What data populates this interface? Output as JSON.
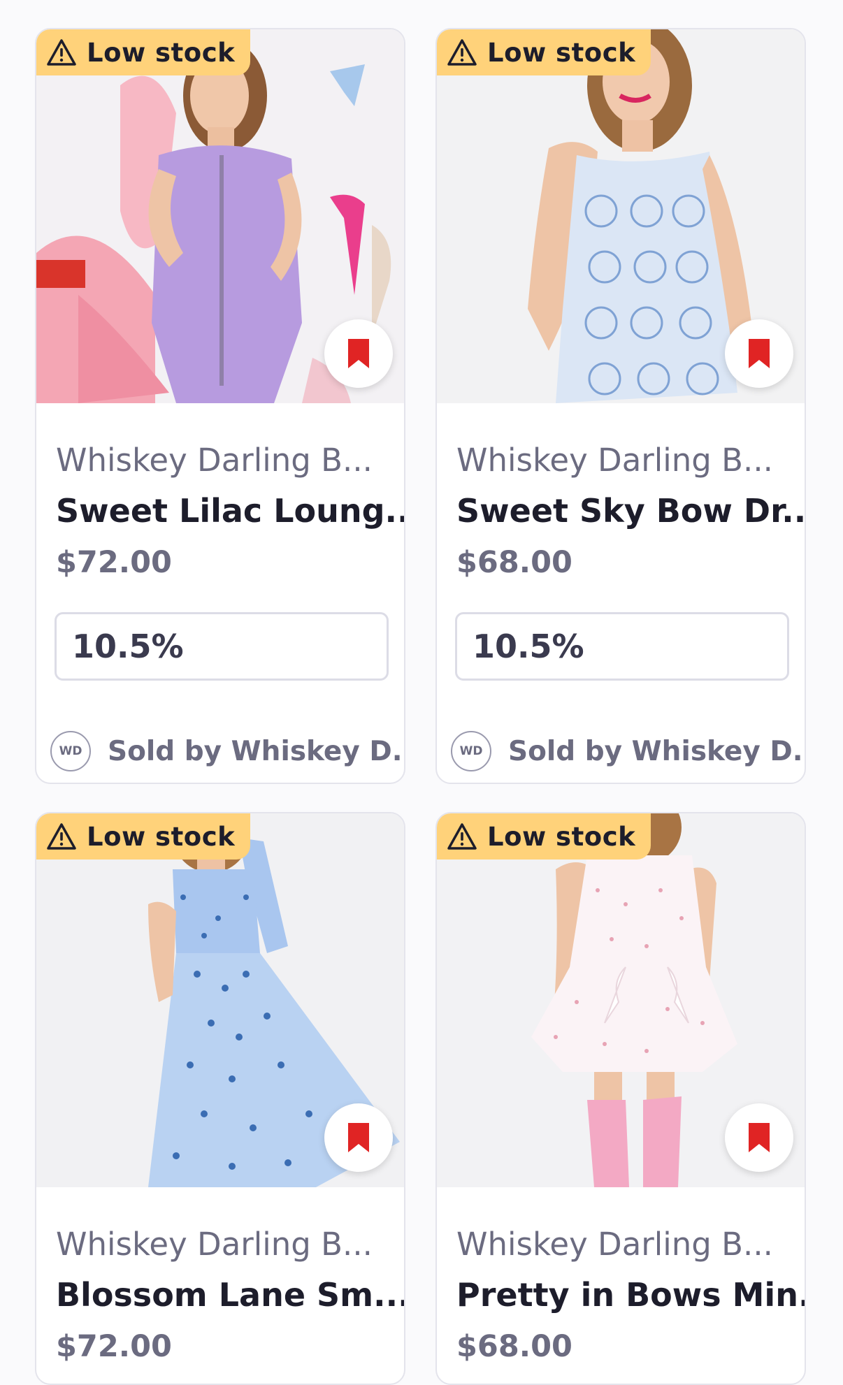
{
  "badge_label": "Low stock",
  "colors": {
    "badge_bg": "#ffd27a",
    "bookmark": "#e02424",
    "text_dark": "#1d1d2b",
    "text_muted": "#6b6b80"
  },
  "products": [
    {
      "brand": "Whiskey Darling B...",
      "title": "Sweet Lilac Loung...",
      "price": "$72.00",
      "commission": "10.5%",
      "seller_initials": "WD",
      "seller": "Sold by Whiskey D..."
    },
    {
      "brand": "Whiskey Darling B...",
      "title": "Sweet Sky Bow Dr...",
      "price": "$68.00",
      "commission": "10.5%",
      "seller_initials": "WD",
      "seller": "Sold by Whiskey D..."
    },
    {
      "brand": "Whiskey Darling B...",
      "title": "Blossom Lane Sm...",
      "price": "$72.00"
    },
    {
      "brand": "Whiskey Darling B...",
      "title": "Pretty in Bows Min...",
      "price": "$68.00"
    }
  ]
}
